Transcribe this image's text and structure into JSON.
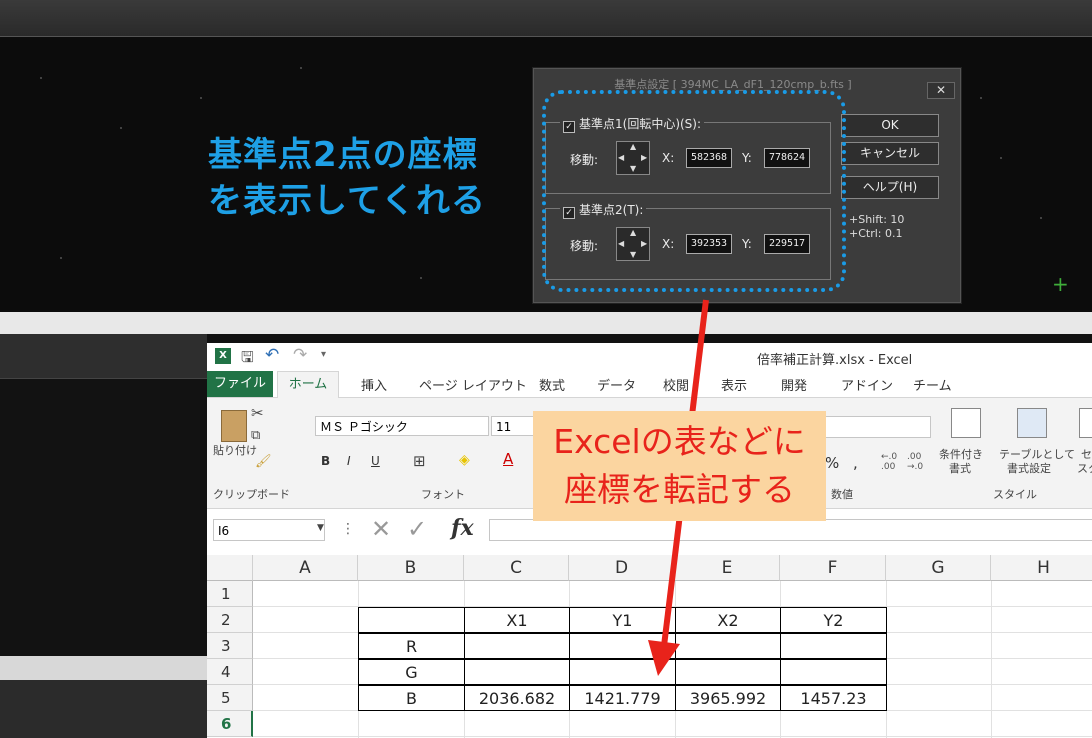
{
  "annotations": {
    "top_callout": [
      "基準点2点の座標",
      "を表示してくれる"
    ],
    "excel_callout": [
      "Excelの表などに",
      "座標を転記する"
    ]
  },
  "dialog": {
    "title": "基準点設定 [ 394MC_LA_dF1_120cmp_b.fts ]",
    "close_label": "✕",
    "point1": {
      "label": "基準点1(回転中心)(S):",
      "checked": true,
      "move_label": "移動:",
      "x_label": "X:",
      "x_value": "582368",
      "y_label": "Y:",
      "y_value": "778624"
    },
    "point2": {
      "label": "基準点2(T):",
      "checked": true,
      "move_label": "移動:",
      "x_label": "X:",
      "x_value": "392353",
      "y_label": "Y:",
      "y_value": "229517"
    },
    "buttons": {
      "ok": "OK",
      "cancel": "キャンセル",
      "help": "ヘルプ(H)"
    },
    "hint_shift": "+Shift: 10",
    "hint_ctrl": "+Ctrl: 0.1"
  },
  "excel": {
    "window_title": "倍率補正計算.xlsx - Excel",
    "tabs": [
      "挿入",
      "ページ レイアウト",
      "数式",
      "データ",
      "校閲",
      "表示",
      "開発",
      "アドイン",
      "チーム"
    ],
    "file_tab": "ファイル",
    "home_tab": "ホーム",
    "ribbon": {
      "paste_label": "貼り付け",
      "clipboard_group": "クリップボード",
      "font_name": "ＭＳ Ｐゴシック",
      "font_size": "11",
      "font_group": "フォント",
      "bold": "B",
      "italic": "I",
      "underline": "U",
      "number_group": "数値",
      "percent": "%",
      "comma": ",",
      "cond_format": [
        "条件付き",
        "書式"
      ],
      "table_format": [
        "テーブルとして",
        "書式設定"
      ],
      "cell_style_partial": [
        "セ",
        "スタ"
      ],
      "style_group": "スタイル"
    },
    "name_box": "I6",
    "fx_label": "fx",
    "columns": [
      "A",
      "B",
      "C",
      "D",
      "E",
      "F",
      "G",
      "H"
    ],
    "rows": [
      "1",
      "2",
      "3",
      "4",
      "5",
      "6"
    ],
    "table": {
      "header": [
        "",
        "X1",
        "Y1",
        "X2",
        "Y2"
      ],
      "rows": [
        [
          "R",
          "",
          "",
          "",
          ""
        ],
        [
          "G",
          "",
          "",
          "",
          ""
        ],
        [
          "B",
          "2036.682",
          "1421.779",
          "3965.992",
          "1457.23"
        ]
      ]
    }
  },
  "colors": {
    "accent_blue": "#1ea0e6",
    "excel_green": "#217346",
    "arrow_red": "#e8231b",
    "callout_bg": "#fbd5a0"
  }
}
